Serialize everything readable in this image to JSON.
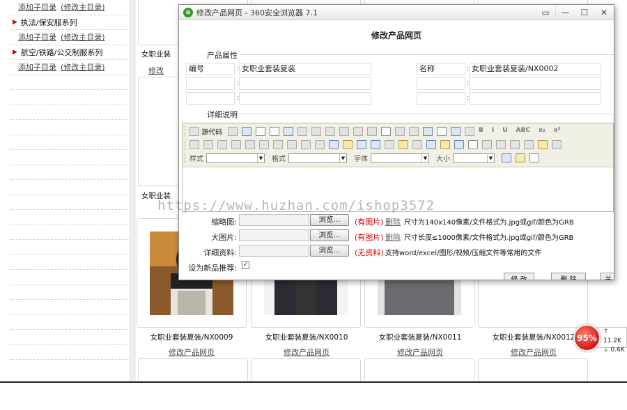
{
  "tree": [
    {
      "type": "sub",
      "add_label": "添加子目录",
      "edit_label": "(修改主目录)"
    },
    {
      "type": "cat",
      "label": "执法/保安服系列"
    },
    {
      "type": "sub",
      "add_label": "添加子目录",
      "edit_label": "(修改主目录)"
    },
    {
      "type": "cat",
      "label": "航空/铁路/公交制服系列"
    },
    {
      "type": "sub",
      "add_label": "添加子目录",
      "edit_label": "(修改主目录)"
    }
  ],
  "grid": {
    "partial_captions": [
      "女职业装",
      "女职业装"
    ],
    "partial_link": "修改",
    "products": [
      {
        "caption": "女职业套装夏装/NX0009",
        "link": "修改产品网页"
      },
      {
        "caption": "女职业套装夏装/NX0010",
        "link": "修改产品网页"
      },
      {
        "caption": "女职业套装夏装/NX0011",
        "link": "修改产品网页"
      },
      {
        "caption": "女职业套装夏装/NX0012",
        "link": "修改产品网页"
      }
    ]
  },
  "popup": {
    "window_title": "修改产品网页 - 360安全浏览器 7.1",
    "heading": "修改产品网页",
    "attr_section": "产品属性",
    "detail_section": "详细说明",
    "fields": {
      "code_label": "编号",
      "code_value": "女职业套装夏装",
      "name_label": "名称",
      "name_value": "女职业套装夏装/NX0002"
    },
    "toolbar": {
      "source_label": "源代码",
      "style_label": "样式",
      "format_label": "格式",
      "font_label": "字体",
      "size_label": "大小"
    },
    "uploads": [
      {
        "label": "缩略图:",
        "browse": "浏览...",
        "status": "(有图片)",
        "delete": "删除",
        "hint": "尺寸为140x140像素/文件格式为.jpg或gif/颜色为GRB"
      },
      {
        "label": "大图片:",
        "browse": "浏览...",
        "status": "(有图片)",
        "delete": "删除",
        "hint": "尺寸长度≤1000像素/文件格式为.jpg或gif/颜色为GRB"
      },
      {
        "label": "详细资料:",
        "browse": "浏览...",
        "status": "(无资料)",
        "delete": "",
        "hint": "支持word/excel/图形/视频/压缩文件等常用的文件"
      }
    ],
    "new_label": "设为新品推荐:",
    "new_checked": true,
    "bottom_buttons": [
      "修 改",
      "删 除",
      "关"
    ]
  },
  "watermark": "https://www.huzhan.com/ishop3572",
  "speed_widget": {
    "percent": "95%",
    "up": "11.2K",
    "down": "0.6K"
  }
}
